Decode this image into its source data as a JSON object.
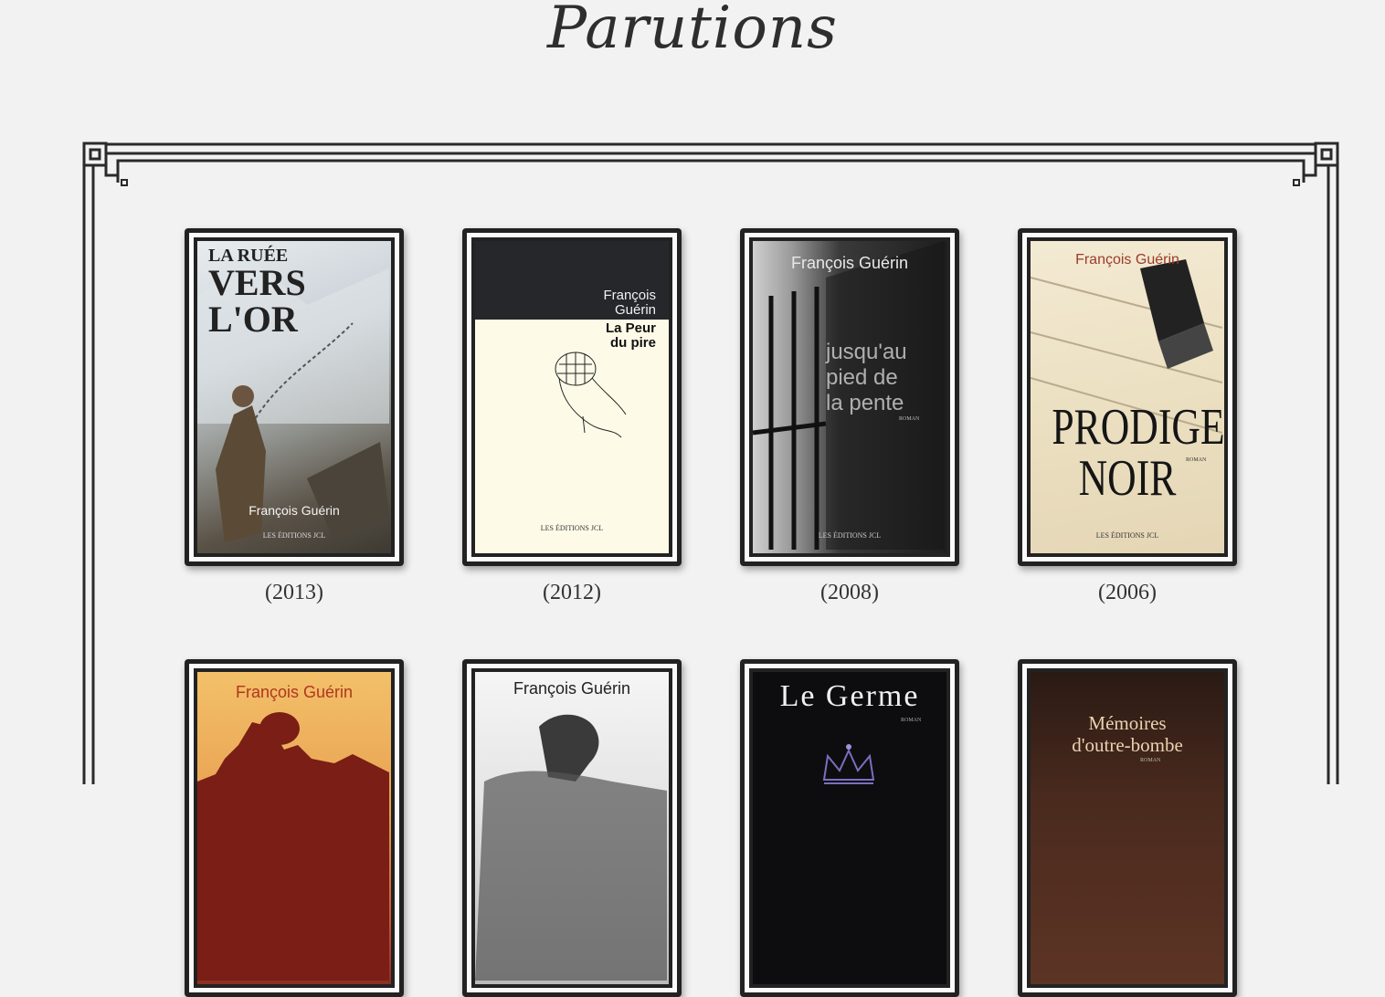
{
  "page": {
    "title": "Parutions"
  },
  "books": [
    {
      "year": "(2013)",
      "title_lines": [
        "LA RUÉE",
        "VERS",
        "L'OR"
      ],
      "author": "François Guérin",
      "publisher": "LES ÉDITIONS JCL"
    },
    {
      "year": "(2012)",
      "title_lines": [
        "La Peur",
        "du pire"
      ],
      "author_lines": [
        "François",
        "Guérin"
      ],
      "publisher": "LES ÉDITIONS JCL"
    },
    {
      "year": "(2008)",
      "title_lines": [
        "jusqu'au",
        "pied de",
        "la pente"
      ],
      "author": "François Guérin",
      "genre": "ROMAN",
      "publisher": "LES ÉDITIONS JCL"
    },
    {
      "year": "(2006)",
      "title_lines": [
        "PRODIGE",
        "NOIR"
      ],
      "author": "François Guérin",
      "genre": "ROMAN",
      "publisher": "LES ÉDITIONS JCL"
    },
    {
      "author": "François Guérin"
    },
    {
      "author": "François Guérin"
    },
    {
      "title": "Le Germe",
      "genre": "ROMAN"
    },
    {
      "title_lines": [
        "Mémoires",
        "d'outre-bombe"
      ],
      "genre": "ROMAN"
    }
  ],
  "colors": {
    "background": "#f2f2f2",
    "frame": "#2a2a2a",
    "book_border": "#222222"
  }
}
